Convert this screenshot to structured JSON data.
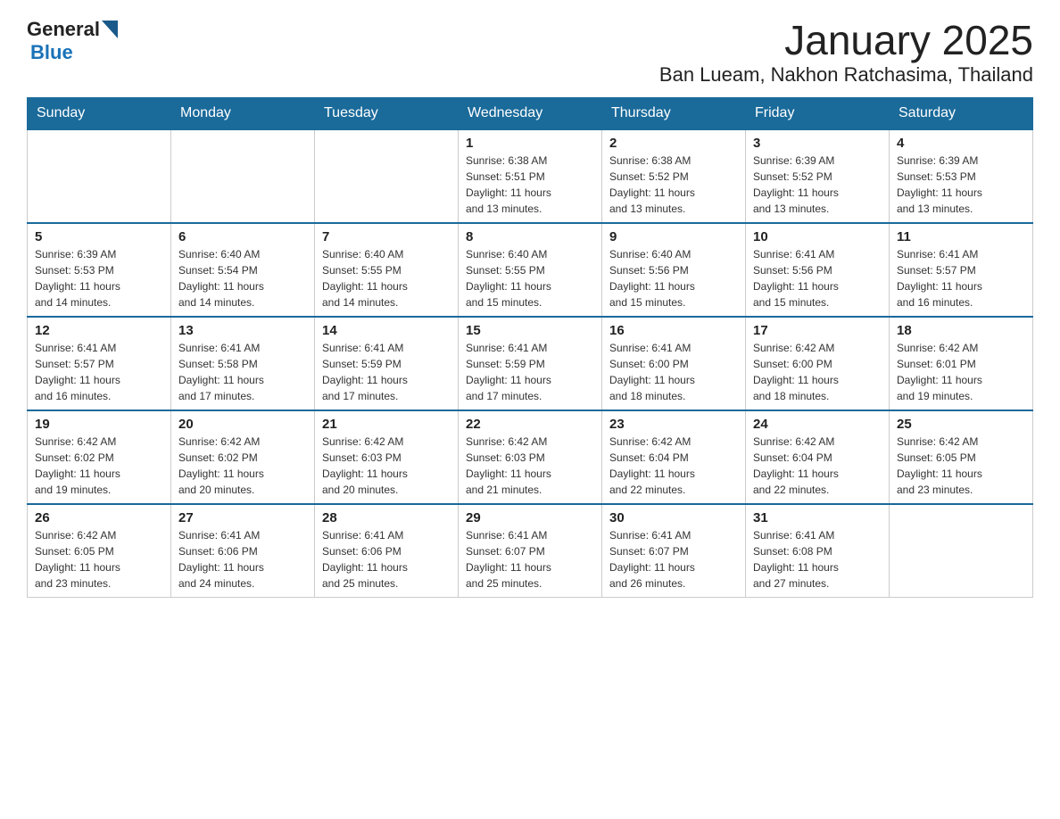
{
  "header": {
    "logo_general": "General",
    "logo_blue": "Blue",
    "title": "January 2025",
    "subtitle": "Ban Lueam, Nakhon Ratchasima, Thailand"
  },
  "weekdays": [
    "Sunday",
    "Monday",
    "Tuesday",
    "Wednesday",
    "Thursday",
    "Friday",
    "Saturday"
  ],
  "weeks": [
    {
      "days": [
        {
          "number": "",
          "info": ""
        },
        {
          "number": "",
          "info": ""
        },
        {
          "number": "",
          "info": ""
        },
        {
          "number": "1",
          "info": "Sunrise: 6:38 AM\nSunset: 5:51 PM\nDaylight: 11 hours\nand 13 minutes."
        },
        {
          "number": "2",
          "info": "Sunrise: 6:38 AM\nSunset: 5:52 PM\nDaylight: 11 hours\nand 13 minutes."
        },
        {
          "number": "3",
          "info": "Sunrise: 6:39 AM\nSunset: 5:52 PM\nDaylight: 11 hours\nand 13 minutes."
        },
        {
          "number": "4",
          "info": "Sunrise: 6:39 AM\nSunset: 5:53 PM\nDaylight: 11 hours\nand 13 minutes."
        }
      ]
    },
    {
      "days": [
        {
          "number": "5",
          "info": "Sunrise: 6:39 AM\nSunset: 5:53 PM\nDaylight: 11 hours\nand 14 minutes."
        },
        {
          "number": "6",
          "info": "Sunrise: 6:40 AM\nSunset: 5:54 PM\nDaylight: 11 hours\nand 14 minutes."
        },
        {
          "number": "7",
          "info": "Sunrise: 6:40 AM\nSunset: 5:55 PM\nDaylight: 11 hours\nand 14 minutes."
        },
        {
          "number": "8",
          "info": "Sunrise: 6:40 AM\nSunset: 5:55 PM\nDaylight: 11 hours\nand 15 minutes."
        },
        {
          "number": "9",
          "info": "Sunrise: 6:40 AM\nSunset: 5:56 PM\nDaylight: 11 hours\nand 15 minutes."
        },
        {
          "number": "10",
          "info": "Sunrise: 6:41 AM\nSunset: 5:56 PM\nDaylight: 11 hours\nand 15 minutes."
        },
        {
          "number": "11",
          "info": "Sunrise: 6:41 AM\nSunset: 5:57 PM\nDaylight: 11 hours\nand 16 minutes."
        }
      ]
    },
    {
      "days": [
        {
          "number": "12",
          "info": "Sunrise: 6:41 AM\nSunset: 5:57 PM\nDaylight: 11 hours\nand 16 minutes."
        },
        {
          "number": "13",
          "info": "Sunrise: 6:41 AM\nSunset: 5:58 PM\nDaylight: 11 hours\nand 17 minutes."
        },
        {
          "number": "14",
          "info": "Sunrise: 6:41 AM\nSunset: 5:59 PM\nDaylight: 11 hours\nand 17 minutes."
        },
        {
          "number": "15",
          "info": "Sunrise: 6:41 AM\nSunset: 5:59 PM\nDaylight: 11 hours\nand 17 minutes."
        },
        {
          "number": "16",
          "info": "Sunrise: 6:41 AM\nSunset: 6:00 PM\nDaylight: 11 hours\nand 18 minutes."
        },
        {
          "number": "17",
          "info": "Sunrise: 6:42 AM\nSunset: 6:00 PM\nDaylight: 11 hours\nand 18 minutes."
        },
        {
          "number": "18",
          "info": "Sunrise: 6:42 AM\nSunset: 6:01 PM\nDaylight: 11 hours\nand 19 minutes."
        }
      ]
    },
    {
      "days": [
        {
          "number": "19",
          "info": "Sunrise: 6:42 AM\nSunset: 6:02 PM\nDaylight: 11 hours\nand 19 minutes."
        },
        {
          "number": "20",
          "info": "Sunrise: 6:42 AM\nSunset: 6:02 PM\nDaylight: 11 hours\nand 20 minutes."
        },
        {
          "number": "21",
          "info": "Sunrise: 6:42 AM\nSunset: 6:03 PM\nDaylight: 11 hours\nand 20 minutes."
        },
        {
          "number": "22",
          "info": "Sunrise: 6:42 AM\nSunset: 6:03 PM\nDaylight: 11 hours\nand 21 minutes."
        },
        {
          "number": "23",
          "info": "Sunrise: 6:42 AM\nSunset: 6:04 PM\nDaylight: 11 hours\nand 22 minutes."
        },
        {
          "number": "24",
          "info": "Sunrise: 6:42 AM\nSunset: 6:04 PM\nDaylight: 11 hours\nand 22 minutes."
        },
        {
          "number": "25",
          "info": "Sunrise: 6:42 AM\nSunset: 6:05 PM\nDaylight: 11 hours\nand 23 minutes."
        }
      ]
    },
    {
      "days": [
        {
          "number": "26",
          "info": "Sunrise: 6:42 AM\nSunset: 6:05 PM\nDaylight: 11 hours\nand 23 minutes."
        },
        {
          "number": "27",
          "info": "Sunrise: 6:41 AM\nSunset: 6:06 PM\nDaylight: 11 hours\nand 24 minutes."
        },
        {
          "number": "28",
          "info": "Sunrise: 6:41 AM\nSunset: 6:06 PM\nDaylight: 11 hours\nand 25 minutes."
        },
        {
          "number": "29",
          "info": "Sunrise: 6:41 AM\nSunset: 6:07 PM\nDaylight: 11 hours\nand 25 minutes."
        },
        {
          "number": "30",
          "info": "Sunrise: 6:41 AM\nSunset: 6:07 PM\nDaylight: 11 hours\nand 26 minutes."
        },
        {
          "number": "31",
          "info": "Sunrise: 6:41 AM\nSunset: 6:08 PM\nDaylight: 11 hours\nand 27 minutes."
        },
        {
          "number": "",
          "info": ""
        }
      ]
    }
  ]
}
